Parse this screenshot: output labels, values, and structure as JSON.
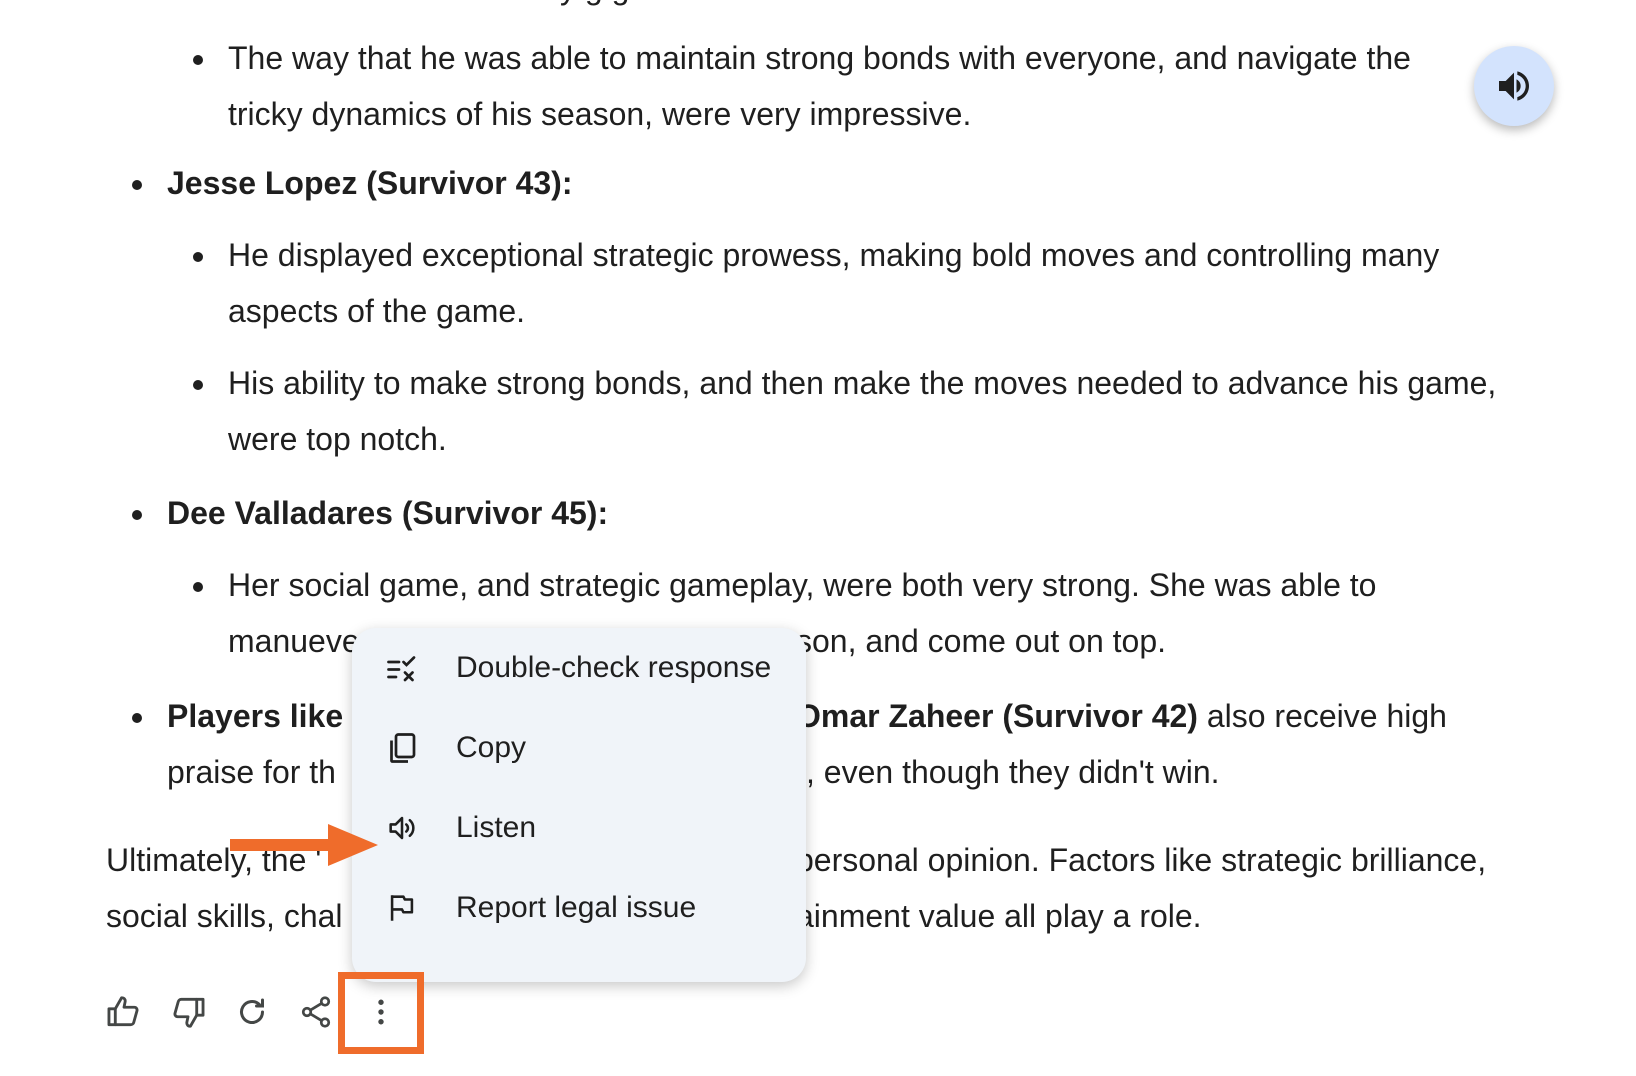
{
  "response": {
    "partial_top_line": "y          g       g",
    "blocks": [
      {
        "kind": "sub",
        "lines": [
          "The way that he was able to maintain strong bonds with everyone, and navigate the",
          "tricky dynamics of his season, were very impressive."
        ]
      },
      {
        "kind": "main",
        "bold": "Jesse Lopez (Survivor 43):"
      },
      {
        "kind": "sub",
        "lines": [
          "He displayed exceptional strategic prowess, making bold moves and controlling many",
          "aspects of the game."
        ]
      },
      {
        "kind": "sub",
        "lines": [
          "His ability to make strong bonds, and then make the moves needed to advance his game,",
          "were top notch."
        ]
      },
      {
        "kind": "main",
        "bold": "Dee Valladares (Survivor 45):"
      },
      {
        "kind": "sub",
        "lines": [
          "Her social game, and strategic gameplay, were both very strong. She was able to",
          "manueve"
        ]
      },
      {
        "kind": "main_partial",
        "left_bold": "Players like",
        "right_bold": "Omar Zaheer (Survivor 42)",
        "right_rest": " also receive high",
        "line2_left": "praise for th",
        "line2_right": ", even though they didn't win."
      }
    ],
    "sub_tail_right": "son, and come out on top.",
    "paragraph": {
      "line1_left": "Ultimately, the '",
      "line1_right": "personal opinion. Factors like strategic brilliance,",
      "line2_left": "social skills, chal",
      "line2_right": "ainment value all play a role."
    }
  },
  "menu": {
    "items": [
      {
        "label": "Double-check response",
        "icon": "double-check-icon"
      },
      {
        "label": "Copy",
        "icon": "copy-icon"
      },
      {
        "label": "Listen",
        "icon": "speaker-icon"
      },
      {
        "label": "Report legal issue",
        "icon": "flag-icon"
      }
    ]
  },
  "toolbar": {
    "icons": [
      "thumbs-up-icon",
      "thumbs-down-icon",
      "regenerate-icon",
      "share-icon",
      "more-vert-icon"
    ]
  },
  "colors": {
    "accent": "#ef6c2b",
    "fab_bg": "#d3e3fd",
    "menu_bg": "#f0f4f9",
    "text": "#1f1f1f",
    "icon": "#444746"
  }
}
